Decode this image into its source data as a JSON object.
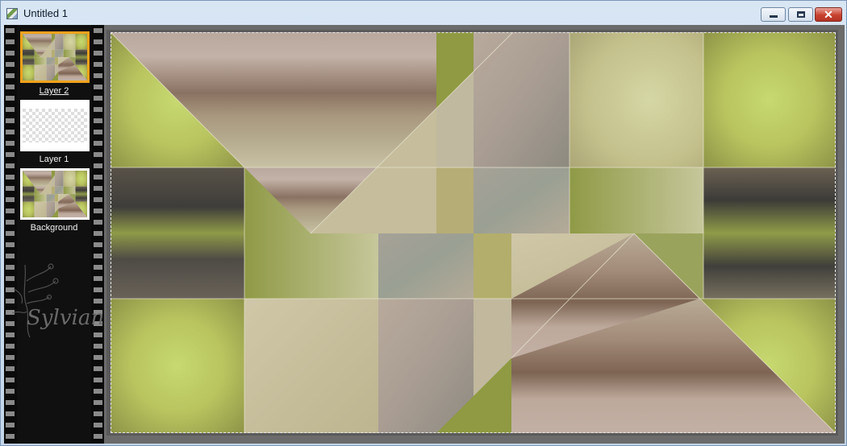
{
  "window": {
    "title": "Untitled 1"
  },
  "titlebar_buttons": {
    "minimize": "minimize",
    "maximize": "maximize",
    "close": "✕"
  },
  "layers": [
    {
      "name": "Layer 2",
      "selected": true
    },
    {
      "name": "Layer 1",
      "selected": false
    },
    {
      "name": "Background",
      "selected": false
    }
  ],
  "watermark": {
    "text": "Sylviane"
  },
  "colors": {
    "accent_selected": "#f0a21c",
    "olive": "#9aa64a",
    "lime": "#c6d36a",
    "taupe": "#bcab9f",
    "brown": "#7b6250",
    "charcoal": "#403f3b"
  }
}
